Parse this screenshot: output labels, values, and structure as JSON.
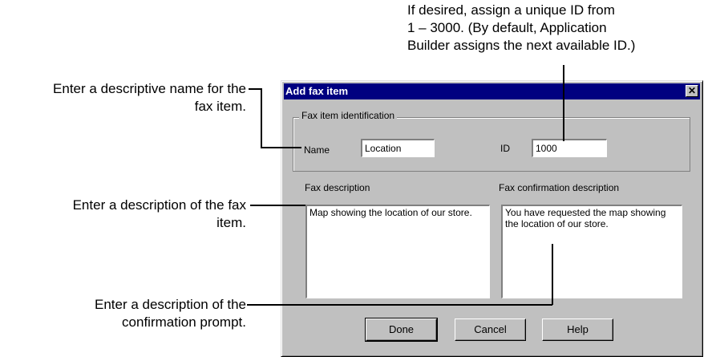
{
  "callouts": {
    "id_hint": [
      "If desired, assign a unique ID from",
      "1 – 3000. (By default, Application",
      "Builder assigns the next available ID.)"
    ],
    "name_hint": [
      "Enter a descriptive name for the",
      "fax item."
    ],
    "desc_hint": [
      "Enter a description of the fax",
      "item."
    ],
    "confirm_hint": [
      "Enter a description of the",
      "confirmation prompt."
    ]
  },
  "dialog": {
    "title": "Add fax item",
    "close_glyph": "✕",
    "group_label": "Fax item identification",
    "name_label": "Name",
    "name_value": "Location",
    "id_label": "ID",
    "id_value": "1000",
    "fax_description_label": "Fax description",
    "fax_description_value": "Map showing the location of our store.",
    "fax_confirmation_label": "Fax confirmation description",
    "fax_confirmation_value": "You have requested the map showing the location of our store.",
    "buttons": {
      "done": "Done",
      "cancel": "Cancel",
      "help": "Help"
    }
  }
}
